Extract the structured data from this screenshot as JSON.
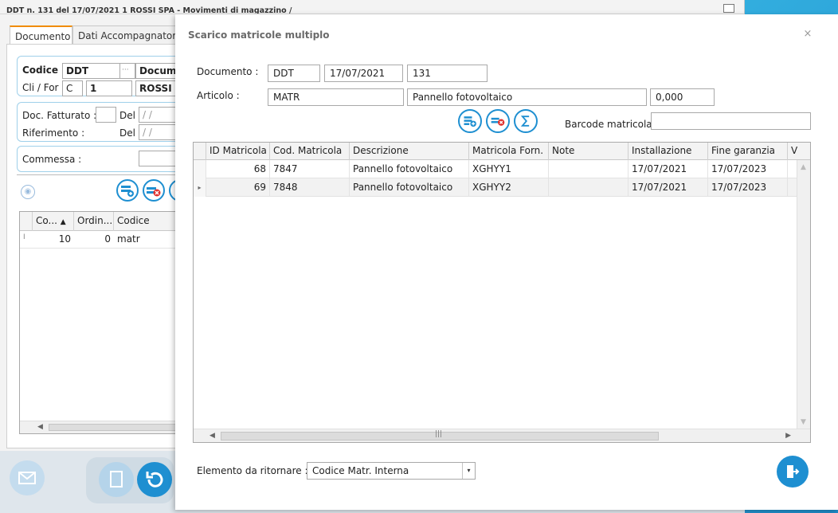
{
  "back_window": {
    "title": "DDT n. 131 del 17/07/2021 1 ROSSI SPA - Movimenti di magazzino / Gestione",
    "tabs": [
      "Documento",
      "Dati Accompagnatori"
    ],
    "codice_label": "Codice :",
    "codice_value": "DDT",
    "codice_dots": "···",
    "codice_desc": "Docume",
    "clifor_label": "Cli / For :",
    "clifor_type": "C",
    "clifor_code": "1",
    "clifor_name": "ROSSI SI",
    "doc_fatturato_label": "Doc. Fatturato :",
    "del_label": "Del :",
    "del_placeholder": "/ /",
    "riferimento_label": "Riferimento :",
    "commessa_label": "Commessa :",
    "grid_headers": [
      "Co...",
      "Ordin...",
      "Codice"
    ],
    "grid_row": {
      "marker": "I",
      "col1": "10",
      "col2": "0",
      "col3": "matr"
    }
  },
  "dialog": {
    "title": "Scarico matricole multiplo",
    "close_glyph": "×",
    "documento_label": "Documento :",
    "documento_tipo": "DDT",
    "documento_data": "17/07/2021",
    "documento_numero": "131",
    "articolo_label": "Articolo :",
    "articolo_codice": "MATR",
    "articolo_desc": "Pannello fotovoltaico",
    "articolo_qta": "0,000",
    "barcode_label": "Barcode matricola :",
    "barcode_value": "",
    "grid": {
      "headers": [
        "ID Matricola",
        "Cod. Matricola",
        "Descrizione",
        "Matricola Forn.",
        "Note",
        "Installazione",
        "Fine garanzia",
        "V"
      ],
      "rows": [
        {
          "marker": "",
          "id": "68",
          "cod": "7847",
          "desc": "Pannello fotovoltaico",
          "forn": "XGHYY1",
          "note": "",
          "inst": "17/07/2021",
          "fine": "17/07/2023"
        },
        {
          "marker": "▸",
          "id": "69",
          "cod": "7848",
          "desc": "Pannello fotovoltaico",
          "forn": "XGHYY2",
          "note": "",
          "inst": "17/07/2021",
          "fine": "17/07/2023"
        }
      ],
      "hscroll_grip": "|||"
    },
    "elemento_label": "Elemento da ritornare :",
    "elemento_value": "Codice Matr. Interna",
    "dropdown_glyph": "▾"
  },
  "icons": [
    "add-record-icon",
    "delete-record-icon",
    "sum-icon",
    "exit-icon",
    "undo-icon",
    "mail-icon",
    "document-icon",
    "eye-icon"
  ],
  "colors": {
    "accent": "#1e8fd1",
    "tab_active": "#f08c00",
    "background": "#2aa7d8"
  }
}
